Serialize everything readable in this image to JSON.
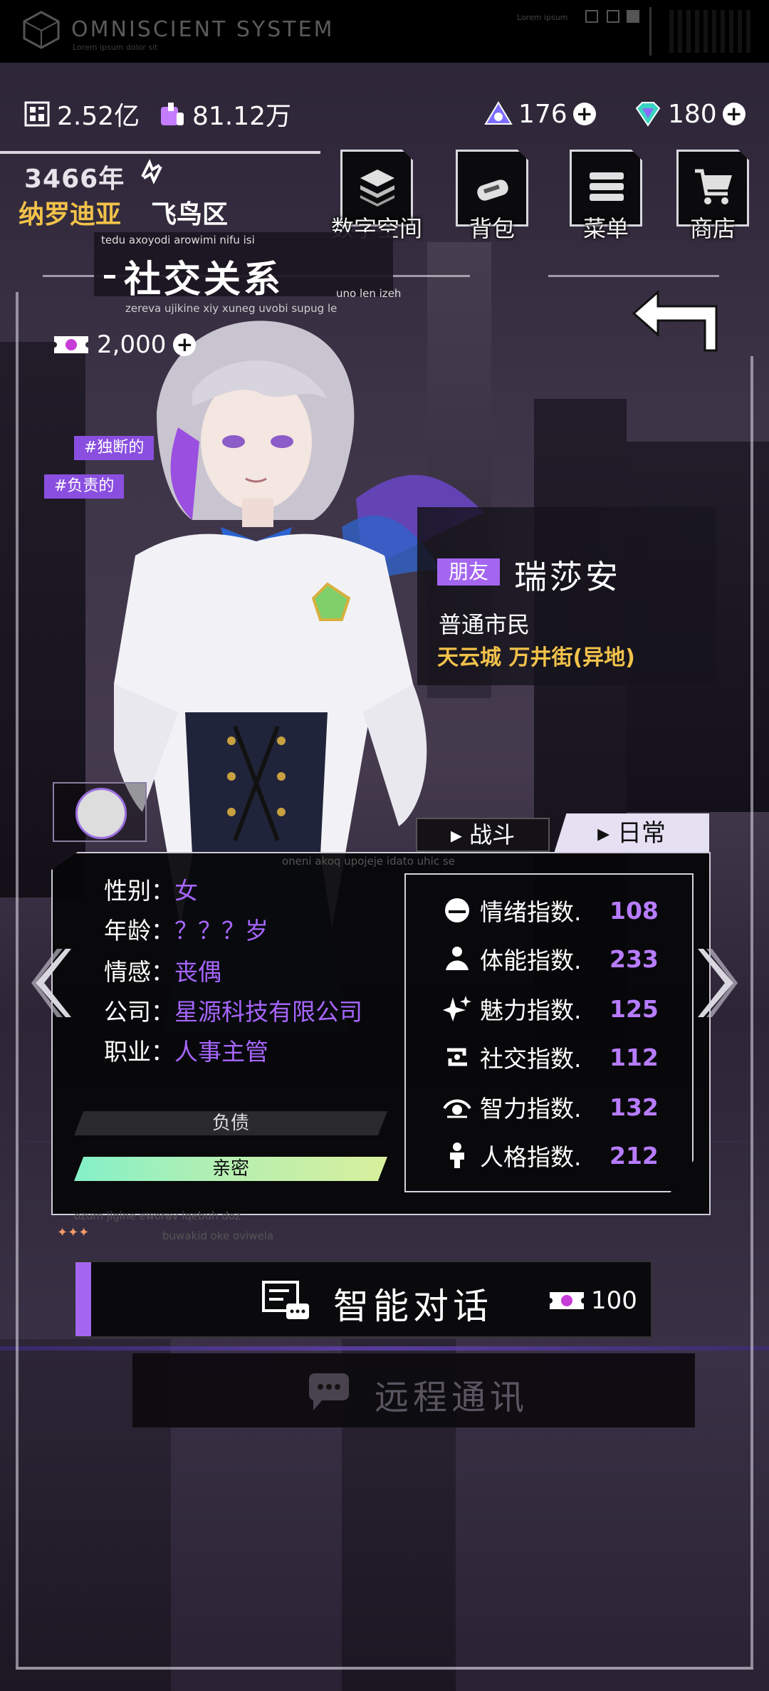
{
  "system": {
    "title": "OMNISCIENT SYSTEM",
    "subtitle": "Lorem ipsum dolor sit",
    "right_text": "Lorem ipsum"
  },
  "currency": {
    "coins": "2.52亿",
    "vouchers": "81.12万",
    "crystal": "176",
    "gem": "180"
  },
  "location": {
    "year": "3466年",
    "region": "纳罗迪亚",
    "district": "飞鸟区"
  },
  "menu": [
    {
      "label": "数字空间",
      "icon": "layers-icon"
    },
    {
      "label": "背包",
      "icon": "bag-icon"
    },
    {
      "label": "菜单",
      "icon": "menu-list-icon"
    },
    {
      "label": "商店",
      "icon": "cart-icon"
    }
  ],
  "section": {
    "title": "社交关系",
    "small_top": "tedu axoyodi arowimi nifu isi",
    "small_bottom": "zereva ujikine xiy xuneg uvobi supug le",
    "small_side": "uno len izeh"
  },
  "token": {
    "amount": "2,000"
  },
  "tags": [
    "#独断的",
    "#负责的"
  ],
  "character": {
    "relation": "朋友",
    "name": "瑞莎安",
    "role": "普通市民",
    "place": "天云城 万井街(异地)"
  },
  "tabs": {
    "battle": "战斗",
    "daily": "日常"
  },
  "panel": {
    "top_text": "oneni akoq upojeje idato uhic se",
    "foot1": "ozum jigine eworav iqebuh doz",
    "foot2": "buwakid oke oviwela",
    "stars": "✦✦✦"
  },
  "info": [
    {
      "label": "性别：",
      "value": "女"
    },
    {
      "label": "年龄：",
      "value": "？？？岁"
    },
    {
      "label": "情感：",
      "value": "丧偶"
    },
    {
      "label": "公司：",
      "value": "星源科技有限公司"
    },
    {
      "label": "职业：",
      "value": "人事主管"
    }
  ],
  "bars": {
    "debt": "负债",
    "intimacy": "亲密",
    "intimacy_level": 1.0
  },
  "stats": [
    {
      "label": "情绪指数.",
      "value": "108",
      "icon": "emotion-icon"
    },
    {
      "label": "体能指数.",
      "value": "233",
      "icon": "stamina-icon"
    },
    {
      "label": "魅力指数.",
      "value": "125",
      "icon": "sparkle-icon"
    },
    {
      "label": "社交指数.",
      "value": "112",
      "icon": "social-icon"
    },
    {
      "label": "智力指数.",
      "value": "132",
      "icon": "eye-icon"
    },
    {
      "label": "人格指数.",
      "value": "212",
      "icon": "person-icon"
    }
  ],
  "actions": {
    "chat": "智能对话",
    "chat_cost": "100",
    "remote": "远程通讯"
  },
  "colors": {
    "accent": "#a466f0",
    "gold": "#f2c24a",
    "value": "#a766ff"
  }
}
